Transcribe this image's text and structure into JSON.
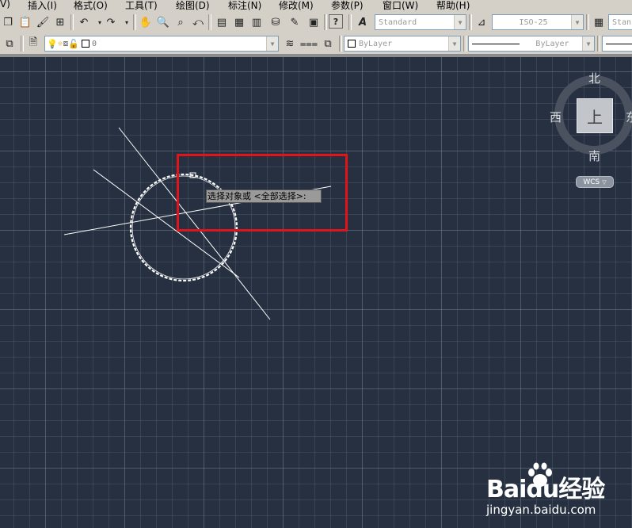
{
  "menu": [
    "V)",
    "插入(I)",
    "格式(O)",
    "工具(T)",
    "绘图(D)",
    "标注(N)",
    "修改(M)",
    "参数(P)",
    "窗口(W)",
    "帮助(H)"
  ],
  "toolbar": {
    "text_style": "Standard",
    "dim_style": "ISO-25",
    "table_style_partial": "Stan",
    "layer_value": "0",
    "color_value": "ByLayer",
    "linetype_value": "ByLayer"
  },
  "viewcube": {
    "north": "北",
    "south": "南",
    "west": "西",
    "east": "东",
    "face": "上",
    "wcs": "WCS"
  },
  "prompt": "选择对象或 <全部选择>:",
  "watermark": {
    "logo": "Baidu经验",
    "url": "jingyan.baidu.com"
  },
  "colors": {
    "canvas": "#263040",
    "highlight": "#e0141b",
    "toolbar": "#d4d0c8"
  }
}
